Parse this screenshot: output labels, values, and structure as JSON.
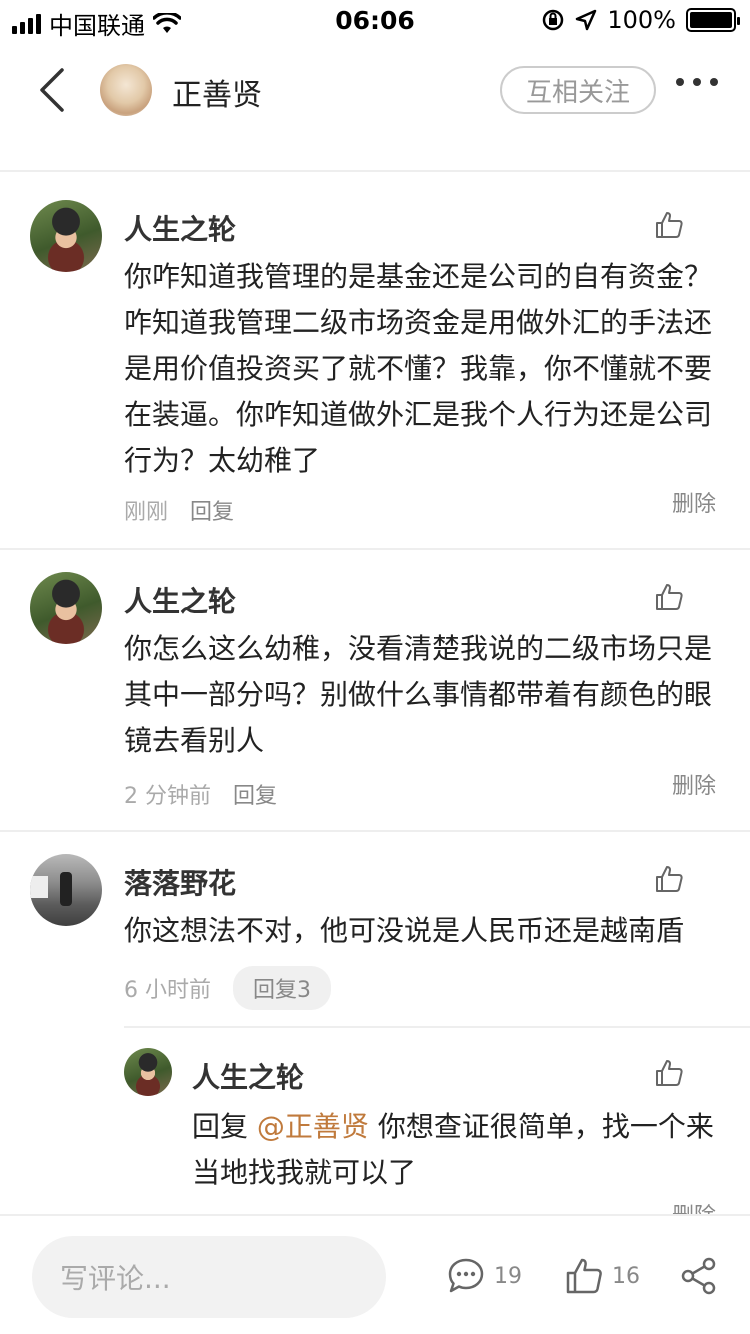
{
  "status_bar": {
    "carrier": "中国联通",
    "time": "06:06",
    "battery": "100%",
    "battery_level": 1.0
  },
  "nav": {
    "title": "正善贤",
    "follow_label": "互相关注"
  },
  "comments": [
    {
      "username": "人生之轮",
      "text": "你咋知道我管理的是基金还是公司的自有资金？咋知道我管理二级市场资金是用做外汇的手法还是用价值投资买了就不懂？我靠，你不懂就不要在装逼。你咋知道做外汇是我个人行为还是公司行为？太幼稚了",
      "time": "刚刚",
      "reply_label": "回复",
      "delete_label": "删除"
    },
    {
      "username": "人生之轮",
      "text": "你怎么这么幼稚，没看清楚我说的二级市场只是其中一部分吗？别做什么事情都带着有颜色的眼镜去看别人",
      "time": "2 分钟前",
      "reply_label": "回复",
      "delete_label": "删除"
    },
    {
      "username": "落落野花",
      "text": "你这想法不对，他可没说是人民币还是越南盾",
      "time": "6 小时前",
      "reply_label": "回复3"
    }
  ],
  "nested_reply": {
    "username": "人生之轮",
    "prefix": "回复",
    "mention": "@正善贤",
    "text": "你想查证很简单，找一个来当地找我就可以了",
    "delete_label": "删除"
  },
  "bottom_bar": {
    "input_placeholder": "写评论...",
    "comment_count": "19",
    "like_count": "16"
  },
  "colors": {
    "mention": "#c07a3c",
    "muted": "#aaaaaa"
  }
}
